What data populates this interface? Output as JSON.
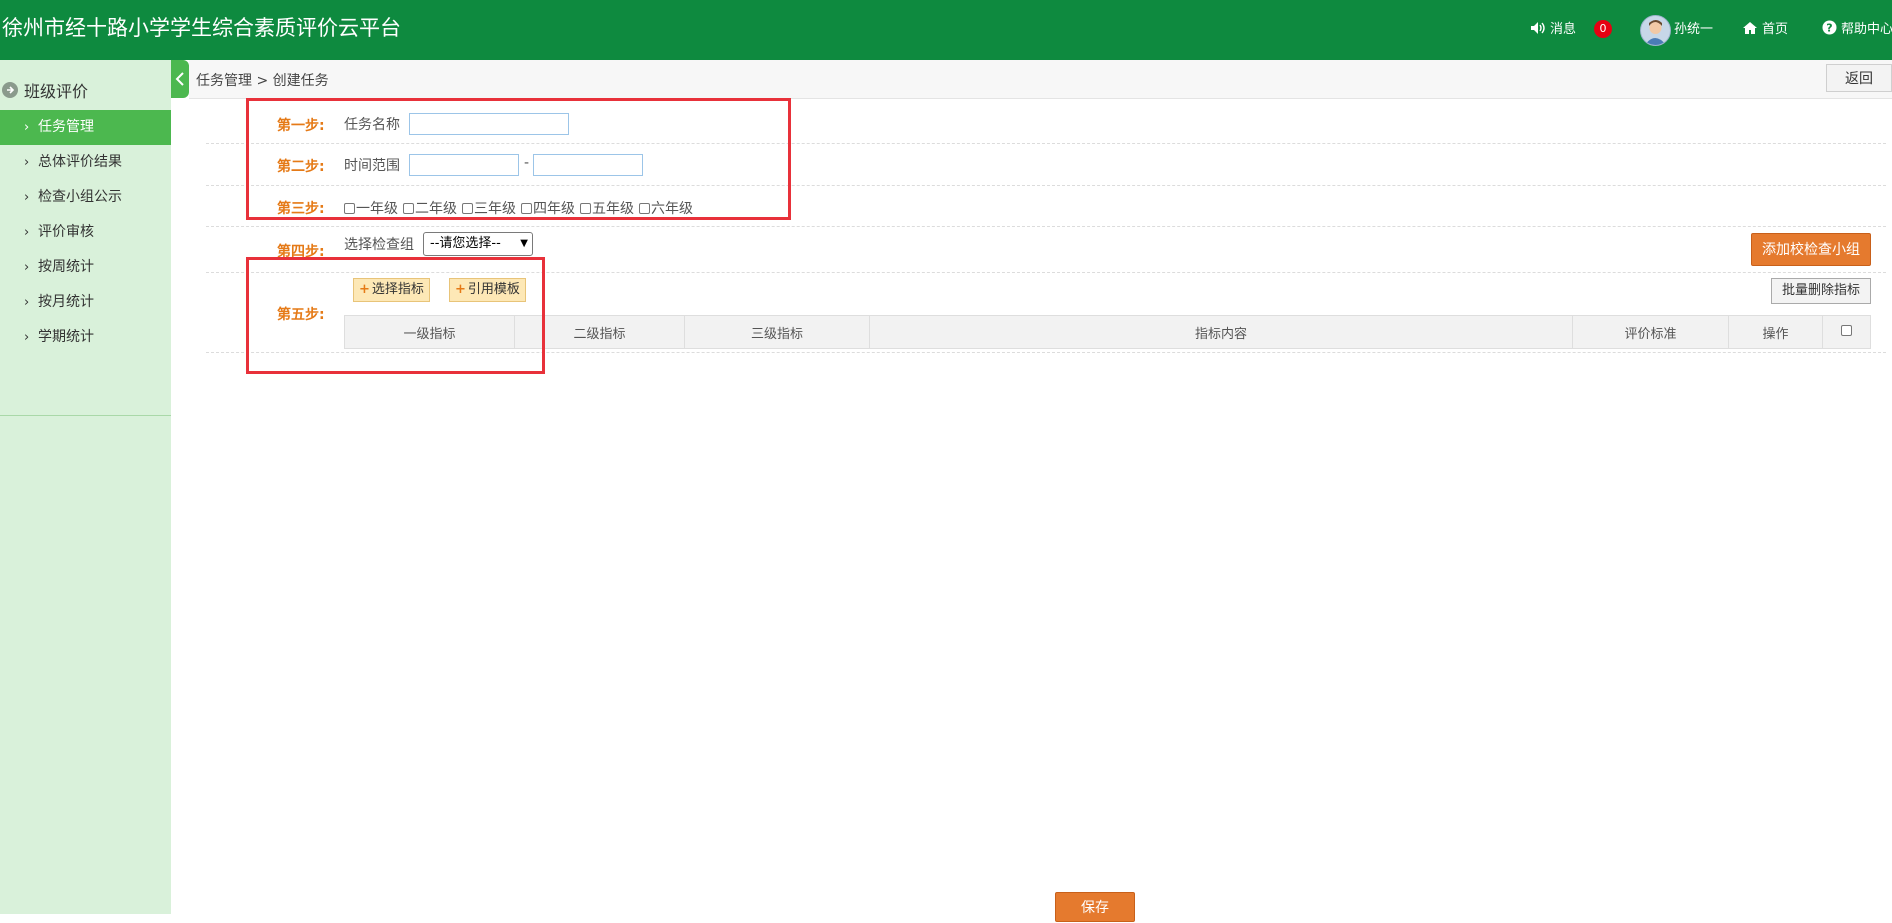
{
  "header": {
    "title": "徐州市经十路小学学生综合素质评价云平台",
    "messages_label": "消息",
    "message_count": "0",
    "user_name": "孙统一",
    "home_label": "首页",
    "help_label": "帮助中心"
  },
  "sidebar": {
    "section_title": "班级评价",
    "items": [
      {
        "label": "任务管理",
        "active": true
      },
      {
        "label": "总体评价结果"
      },
      {
        "label": "检查小组公示"
      },
      {
        "label": "评价审核"
      },
      {
        "label": "按周统计"
      },
      {
        "label": "按月统计"
      },
      {
        "label": "学期统计"
      }
    ]
  },
  "breadcrumb": {
    "text": "任务管理 > 创建任务"
  },
  "back_button": "返回",
  "steps": {
    "step1": {
      "label": "第一步:",
      "field": "任务名称",
      "value": ""
    },
    "step2": {
      "label": "第二步:",
      "field": "时间范围",
      "separator": "-",
      "start": "",
      "end": ""
    },
    "step3": {
      "label": "第三步:",
      "grades": [
        "一年级",
        "二年级",
        "三年级",
        "四年级",
        "五年级",
        "六年级"
      ]
    },
    "step4": {
      "label": "第四步:",
      "field": "选择检查组",
      "select_value": "--请您选择--",
      "add_group_button": "添加校检查小组"
    },
    "step5": {
      "label": "第五步:",
      "select_indicator_button": "选择指标",
      "use_template_button": "引用模板",
      "batch_delete_button": "批量删除指标",
      "columns": [
        "一级指标",
        "二级指标",
        "三级指标",
        "指标内容",
        "评价标准",
        "操作"
      ]
    }
  },
  "save_button": "保存",
  "colors": {
    "header_green": "#0e8a3f",
    "active_green": "#4cb84f",
    "sidebar_bg": "#d9f1da",
    "step_orange": "#e57a17",
    "highlight_red": "#e8313a"
  }
}
